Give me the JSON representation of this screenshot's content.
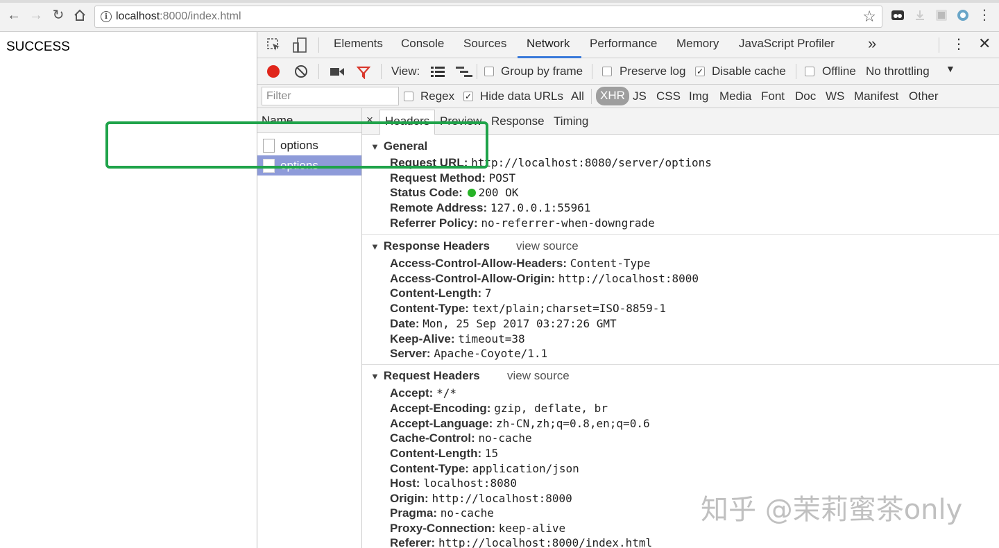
{
  "browser": {
    "url_host": "localhost",
    "url_rest": ":8000/index.html"
  },
  "page": {
    "message": "SUCCESS"
  },
  "devtools": {
    "tabs": [
      "Elements",
      "Console",
      "Sources",
      "Network",
      "Performance",
      "Memory",
      "JavaScript Profiler"
    ],
    "active_tab": "Network",
    "more_tabs": "»",
    "controls": {
      "view_label": "View:",
      "group_by_frame": "Group by frame",
      "preserve_log": "Preserve log",
      "disable_cache": "Disable cache",
      "offline": "Offline",
      "throttling": "No throttling"
    },
    "filter": {
      "placeholder": "Filter",
      "regex": "Regex",
      "hide_data_urls": "Hide data URLs",
      "types": [
        "All",
        "XHR",
        "JS",
        "CSS",
        "Img",
        "Media",
        "Font",
        "Doc",
        "WS",
        "Manifest",
        "Other"
      ],
      "active_type": "XHR"
    },
    "request_list": {
      "header": "Name",
      "items": [
        "options",
        "options"
      ],
      "selected_index": 1
    },
    "detail": {
      "close": "×",
      "tabs": [
        "Headers",
        "Preview",
        "Response",
        "Timing"
      ],
      "active_tab": "Headers",
      "general": {
        "title": "General",
        "rows": [
          {
            "k": "Request URL:",
            "v": "http://localhost:8080/server/options"
          },
          {
            "k": "Request Method:",
            "v": "POST"
          },
          {
            "k": "Status Code:",
            "v": "200 OK"
          },
          {
            "k": "Remote Address:",
            "v": "127.0.0.1:55961"
          },
          {
            "k": "Referrer Policy:",
            "v": "no-referrer-when-downgrade"
          }
        ]
      },
      "response_headers": {
        "title": "Response Headers",
        "view_source": "view source",
        "rows": [
          {
            "k": "Access-Control-Allow-Headers:",
            "v": "Content-Type"
          },
          {
            "k": "Access-Control-Allow-Origin:",
            "v": "http://localhost:8000"
          },
          {
            "k": "Content-Length:",
            "v": "7"
          },
          {
            "k": "Content-Type:",
            "v": "text/plain;charset=ISO-8859-1"
          },
          {
            "k": "Date:",
            "v": "Mon, 25 Sep 2017 03:27:26 GMT"
          },
          {
            "k": "Keep-Alive:",
            "v": "timeout=38"
          },
          {
            "k": "Server:",
            "v": "Apache-Coyote/1.1"
          }
        ]
      },
      "request_headers": {
        "title": "Request Headers",
        "view_source": "view source",
        "rows": [
          {
            "k": "Accept:",
            "v": "*/*"
          },
          {
            "k": "Accept-Encoding:",
            "v": "gzip, deflate, br"
          },
          {
            "k": "Accept-Language:",
            "v": "zh-CN,zh;q=0.8,en;q=0.6"
          },
          {
            "k": "Cache-Control:",
            "v": "no-cache"
          },
          {
            "k": "Content-Length:",
            "v": "15"
          },
          {
            "k": "Content-Type:",
            "v": "application/json"
          },
          {
            "k": "Host:",
            "v": "localhost:8080"
          },
          {
            "k": "Origin:",
            "v": "http://localhost:8000"
          },
          {
            "k": "Pragma:",
            "v": "no-cache"
          },
          {
            "k": "Proxy-Connection:",
            "v": "keep-alive"
          },
          {
            "k": "Referer:",
            "v": "http://localhost:8000/index.html"
          }
        ]
      }
    }
  },
  "watermark": "知乎 @茉莉蜜茶only",
  "colors": {
    "highlight": "#1fa34a",
    "record": "#e0261b",
    "filter_icon": "#d9382c",
    "selected_row": "#8e9bd9",
    "status_ok": "#27b327"
  }
}
